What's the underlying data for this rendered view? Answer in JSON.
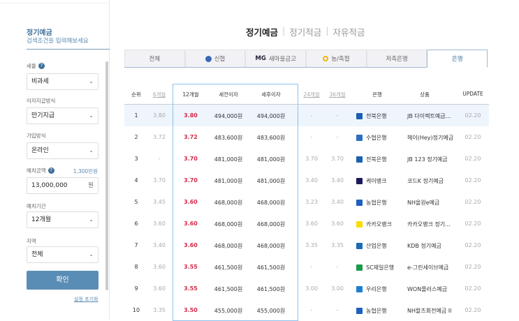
{
  "sidebar": {
    "title": "정기예금",
    "subtitle": "검색조건을 입력해보세요",
    "fields": {
      "tax_label": "세율",
      "tax_value": "비과세",
      "interest_label": "이자지급방식",
      "interest_value": "만기지급",
      "join_label": "가입방식",
      "join_value": "온라인",
      "amount_label": "예치금액",
      "amount_hint": "1,300만원",
      "amount_value": "13,000,000",
      "amount_unit": "원",
      "period_label": "예치기간",
      "period_value": "12개월",
      "region_label": "지역",
      "region_value": "전체"
    },
    "confirm": "확인",
    "reset": "설정 초기화"
  },
  "main_tabs": [
    "정기예금",
    "정기적금",
    "자유적금"
  ],
  "tabs": [
    "전체",
    "신협",
    "새마을금고",
    "농/축협",
    "저축은행",
    "은행"
  ],
  "tab_mg": "MG",
  "headers": [
    "순위",
    "6개월",
    "12개월",
    "세전이자",
    "세후이자",
    "24개월",
    "36개월",
    "은행",
    "상품",
    "UPDATE"
  ],
  "rows": [
    [
      "1",
      "3.80",
      "3.80",
      "494,000원",
      "494,000원",
      "-",
      "-",
      "전북은행",
      "JB 다이렉트예금…",
      "02.20"
    ],
    [
      "2",
      "3.72",
      "3.72",
      "483,600원",
      "483,600원",
      "-",
      "-",
      "수협은행",
      "헤이(Hey)정기예금",
      "02.20"
    ],
    [
      "3",
      "-",
      "3.70",
      "481,000원",
      "481,000원",
      "3.70",
      "3.70",
      "전북은행",
      "JB 123 정기예금",
      "02.20"
    ],
    [
      "4",
      "3.70",
      "3.70",
      "481,000원",
      "481,000원",
      "3.40",
      "3.40",
      "케이뱅크",
      "코드K 정기예금",
      "02.20"
    ],
    [
      "5",
      "3.45",
      "3.60",
      "468,000원",
      "468,000원",
      "3.23",
      "3.40",
      "농협은행",
      "NH올원e예금",
      "02.20"
    ],
    [
      "6",
      "3.60",
      "3.60",
      "468,000원",
      "468,000원",
      "3.60",
      "3.60",
      "카카오뱅크",
      "카카오뱅크 정기…",
      "02.20"
    ],
    [
      "7",
      "3.40",
      "3.60",
      "468,000원",
      "468,000원",
      "3.35",
      "3.35",
      "산업은행",
      "KDB 정기예금",
      "02.20"
    ],
    [
      "8",
      "3.60",
      "3.55",
      "461,500원",
      "461,500원",
      "-",
      "-",
      "SC제일은행",
      "e-그린세이브예금",
      "02.20"
    ],
    [
      "9",
      "3.60",
      "3.55",
      "461,500원",
      "461,500원",
      "3.00",
      "3.00",
      "우리은행",
      "WON플러스예금",
      "02.20"
    ],
    [
      "10",
      "3.35",
      "3.50",
      "455,000원",
      "455,000원",
      "-",
      "-",
      "농협은행",
      "NH왈츠회전예금 II",
      "02.20"
    ]
  ],
  "bank_logos": {
    "전북은행": "#1c5fb0",
    "수협은행": "#2a6fc0",
    "케이뱅크": "#1a1a5a",
    "농협은행": "#1f5fbf",
    "카카오뱅크": "#f9dc00",
    "산업은행": "#1c6ab8",
    "SC제일은행": "#1a9a4a",
    "우리은행": "#1a7fd0"
  },
  "colors": {
    "accent": "#3d6f99",
    "highlight": "#d42a4a"
  }
}
